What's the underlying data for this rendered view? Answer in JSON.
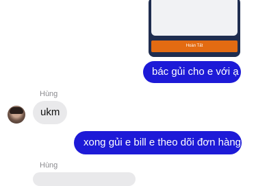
{
  "shared_image": {
    "button_label": "Hoàn Tất"
  },
  "messages": [
    {
      "direction": "out",
      "text": "bác gủi cho e với ạ"
    },
    {
      "direction": "in",
      "sender": "Hùng",
      "text": "ukm"
    },
    {
      "direction": "out",
      "text": "xong gủi e bill e theo dõi đơn hàng"
    },
    {
      "direction": "in",
      "sender": "Hùng",
      "text": ""
    }
  ],
  "colors": {
    "outgoing_bubble": "#1d1ad7",
    "incoming_bubble": "#e9e9eb",
    "sender_name": "#8a8a8e",
    "preview_button": "#e36b12"
  },
  "icons": {
    "avatar": "user-avatar-photo"
  }
}
